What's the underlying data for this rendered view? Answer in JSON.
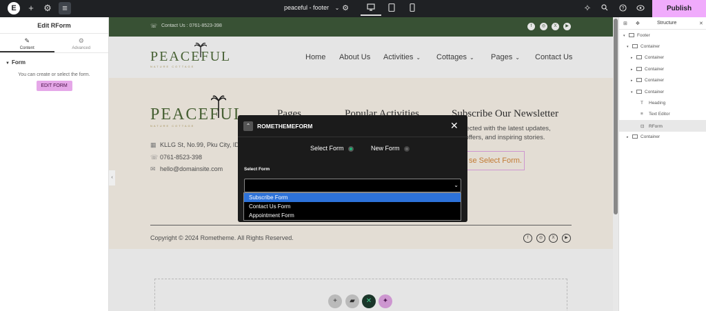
{
  "topbar": {
    "logo": "E",
    "add": "+",
    "settings": "⚙",
    "layers": "≡",
    "document_title": "peaceful - footer",
    "chevron": "⌄",
    "publish_label": "Publish"
  },
  "left_panel": {
    "title": "Edit RForm",
    "tabs": [
      {
        "icon": "✎",
        "label": "Content"
      },
      {
        "icon": "⚙",
        "label": "Advanced"
      }
    ],
    "section_label": "Form",
    "help_text": "You can create or select the form.",
    "edit_button": "EDIT FORM"
  },
  "site": {
    "contact": "Contact Us : 0761-8523-398",
    "logo_text": "PEACEFUL",
    "logo_sub": "NATURE COTTAGE",
    "nav": [
      "Home",
      "About Us",
      "Activities",
      "Cottages",
      "Pages",
      "Contact Us"
    ],
    "footer_headings": [
      "Pages",
      "Popular Activities",
      "Subscribe Our Newsletter"
    ],
    "address": "KLLG St, No.99, Pku City, ID",
    "phone": "0761-8523-398",
    "email": "hello@domainsite.com",
    "newsletter_line1": "connected with the latest updates,",
    "newsletter_line2": "sive offers, and inspiring stories.",
    "newsletter_button": "se Select Form.",
    "copyright": "Copyright © 2024 Rometheme. All Rights Reserved.",
    "social_icons": [
      "facebook-icon",
      "instagram-icon",
      "x-icon",
      "youtube-icon"
    ]
  },
  "modal": {
    "title": "ROMETHEMEFORM",
    "close": "✕",
    "option_select": "Select Form",
    "option_new": "New Form",
    "select_label": "Select Form",
    "options": [
      "Subscribe Form",
      "Contact Us Form",
      "Appointment Form"
    ],
    "highlighted_option": "Subscribe Form"
  },
  "structure": {
    "title": "Structure",
    "items": [
      {
        "label": "Footer",
        "level": 0,
        "arrow": "▾"
      },
      {
        "label": "Container",
        "level": 1,
        "arrow": "▾"
      },
      {
        "label": "Container",
        "level": 2,
        "arrow": "▸"
      },
      {
        "label": "Container",
        "level": 2,
        "arrow": "▸"
      },
      {
        "label": "Container",
        "level": 2,
        "arrow": "▸"
      },
      {
        "label": "Container",
        "level": 2,
        "arrow": "▾"
      },
      {
        "label": "Heading",
        "level": 3,
        "arrow": ""
      },
      {
        "label": "Text Editor",
        "level": 3,
        "arrow": ""
      },
      {
        "label": "RForm",
        "level": 3,
        "arrow": ""
      },
      {
        "label": "Container",
        "level": 1,
        "arrow": "▸"
      }
    ]
  },
  "colors": {
    "publish": "#f0abfc",
    "site_green": "#3f5b3a",
    "modal_bg": "#1b1b1b",
    "radio_active": "#1fb575",
    "select_highlight": "#2d72d9"
  }
}
